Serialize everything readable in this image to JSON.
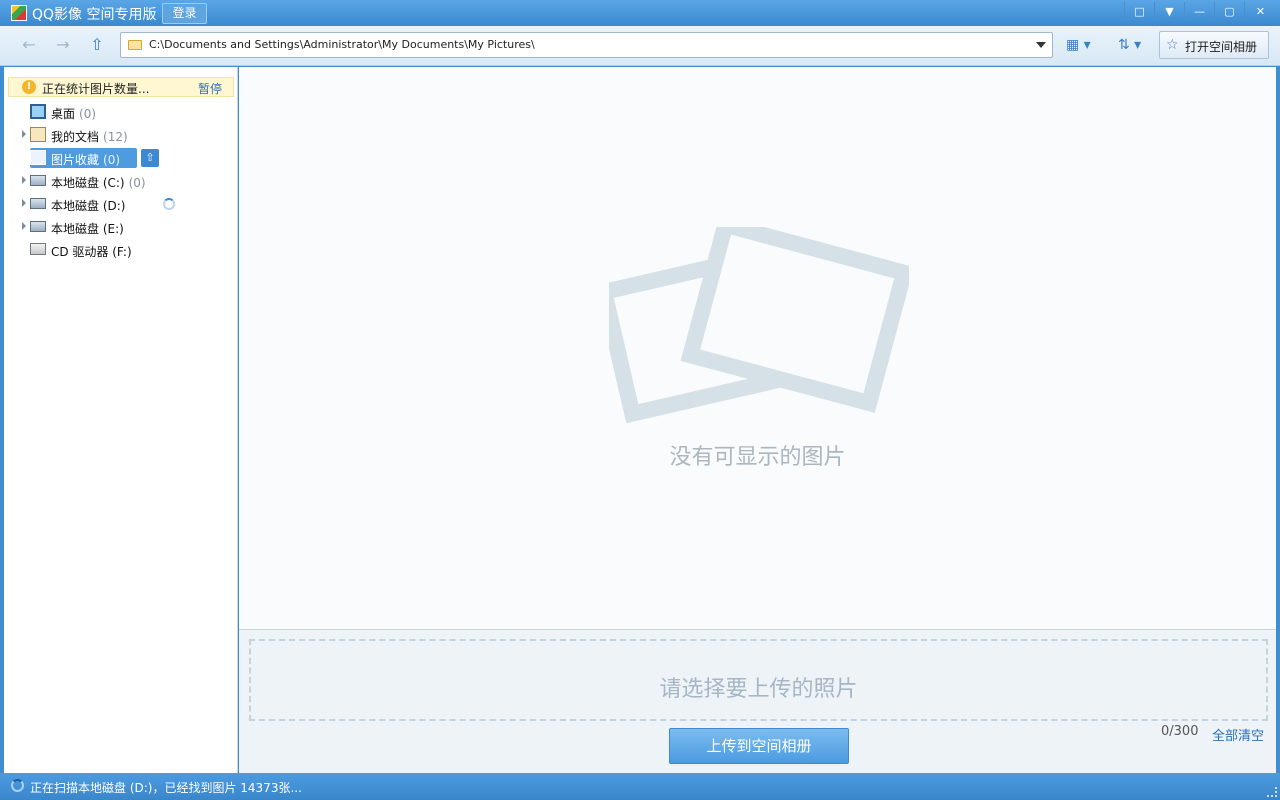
{
  "title_bar": {
    "title": "QQ影像 空间专用版",
    "login_label": "登录",
    "window_buttons": [
      "feedback-icon",
      "menu-icon",
      "minimize-icon",
      "maximize-icon",
      "close-icon"
    ]
  },
  "toolbar": {
    "address": "C:\\Documents and Settings\\Administrator\\My Documents\\My Pictures\\",
    "open_album_label": "打开空间相册"
  },
  "sidebar": {
    "notice_text": "正在统计图片数量...",
    "pause_label": "暂停",
    "items": [
      {
        "label": "桌面",
        "count": "(0)"
      },
      {
        "label": "我的文档",
        "count": "(12)"
      },
      {
        "label": "图片收藏",
        "count": "(0)"
      },
      {
        "label": "本地磁盘 (C:)",
        "count": "(0)"
      },
      {
        "label": "本地磁盘 (D:)",
        "count": ""
      },
      {
        "label": "本地磁盘 (E:)",
        "count": ""
      },
      {
        "label": "CD 驱动器 (F:)",
        "count": ""
      }
    ]
  },
  "main": {
    "empty_text": "没有可显示的图片"
  },
  "upload": {
    "dropzone_text": "请选择要上传的照片",
    "upload_button": "上传到空间相册",
    "counter": "0/300",
    "clear_all": "全部清空"
  },
  "status": {
    "text": "正在扫描本地磁盘 (D:)，已经找到图片 14373张..."
  },
  "colors": {
    "accent": "#3f8ed2",
    "link": "#2b6fb8",
    "notice_bg": "#fff7d1"
  }
}
